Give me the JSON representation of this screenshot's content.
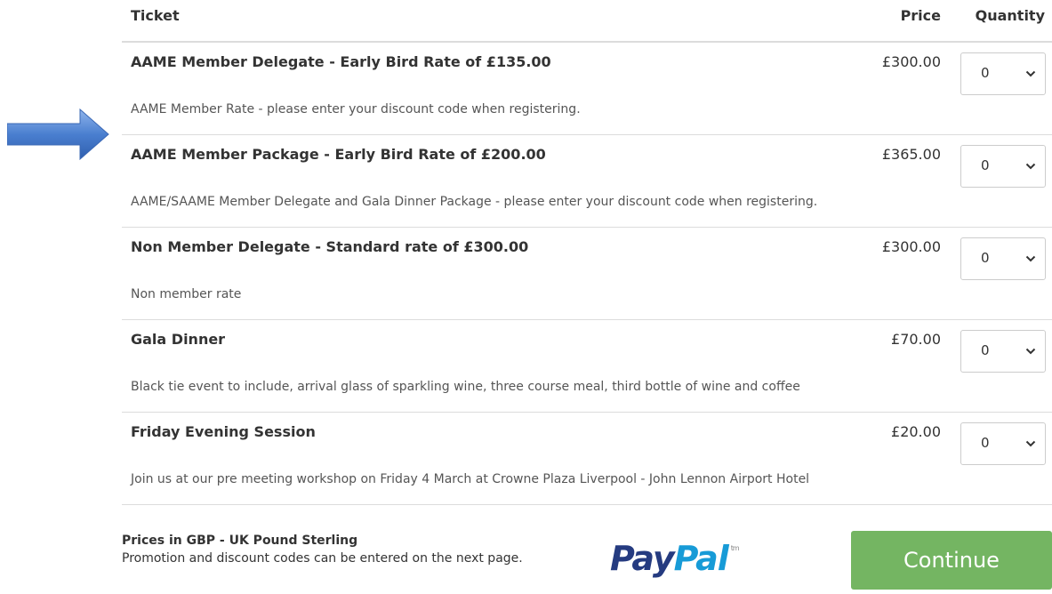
{
  "header": {
    "ticket": "Ticket",
    "price": "Price",
    "quantity": "Quantity"
  },
  "tickets": [
    {
      "name": "AAME Member Delegate - Early Bird Rate of £135.00",
      "price": "£300.00",
      "quantity": "0",
      "description": "AAME Member Rate - please enter your discount code when registering."
    },
    {
      "name": "AAME Member Package - Early Bird Rate of £200.00",
      "price": "£365.00",
      "quantity": "0",
      "description": "AAME/SAAME Member Delegate and Gala Dinner Package - please enter your discount code when registering."
    },
    {
      "name": "Non Member Delegate - Standard rate of £300.00",
      "price": "£300.00",
      "quantity": "0",
      "description": "Non member rate"
    },
    {
      "name": "Gala Dinner",
      "price": "£70.00",
      "quantity": "0",
      "description": "Black tie event to include, arrival glass of sparkling wine, three course meal, third bottle of wine and coffee"
    },
    {
      "name": "Friday Evening Session",
      "price": "£20.00",
      "quantity": "0",
      "description": "Join us at our pre meeting workshop on Friday 4 March at Crowne Plaza Liverpool - John Lennon Airport Hotel"
    }
  ],
  "footer": {
    "currency_note": "Prices in GBP - UK Pound Sterling",
    "promo_note": "Promotion and discount codes can be entered on the next page.",
    "paypal_pay": "Pay",
    "paypal_pal": "Pal",
    "paypal_tm": "tm",
    "continue_label": "Continue"
  },
  "colors": {
    "continue_button": "#74b562",
    "arrow": "#4a7fd0",
    "paypal_dark": "#253b80",
    "paypal_light": "#179bd7"
  },
  "icons": {
    "arrow": "right-arrow-icon",
    "select": "chevron-down-icon"
  }
}
